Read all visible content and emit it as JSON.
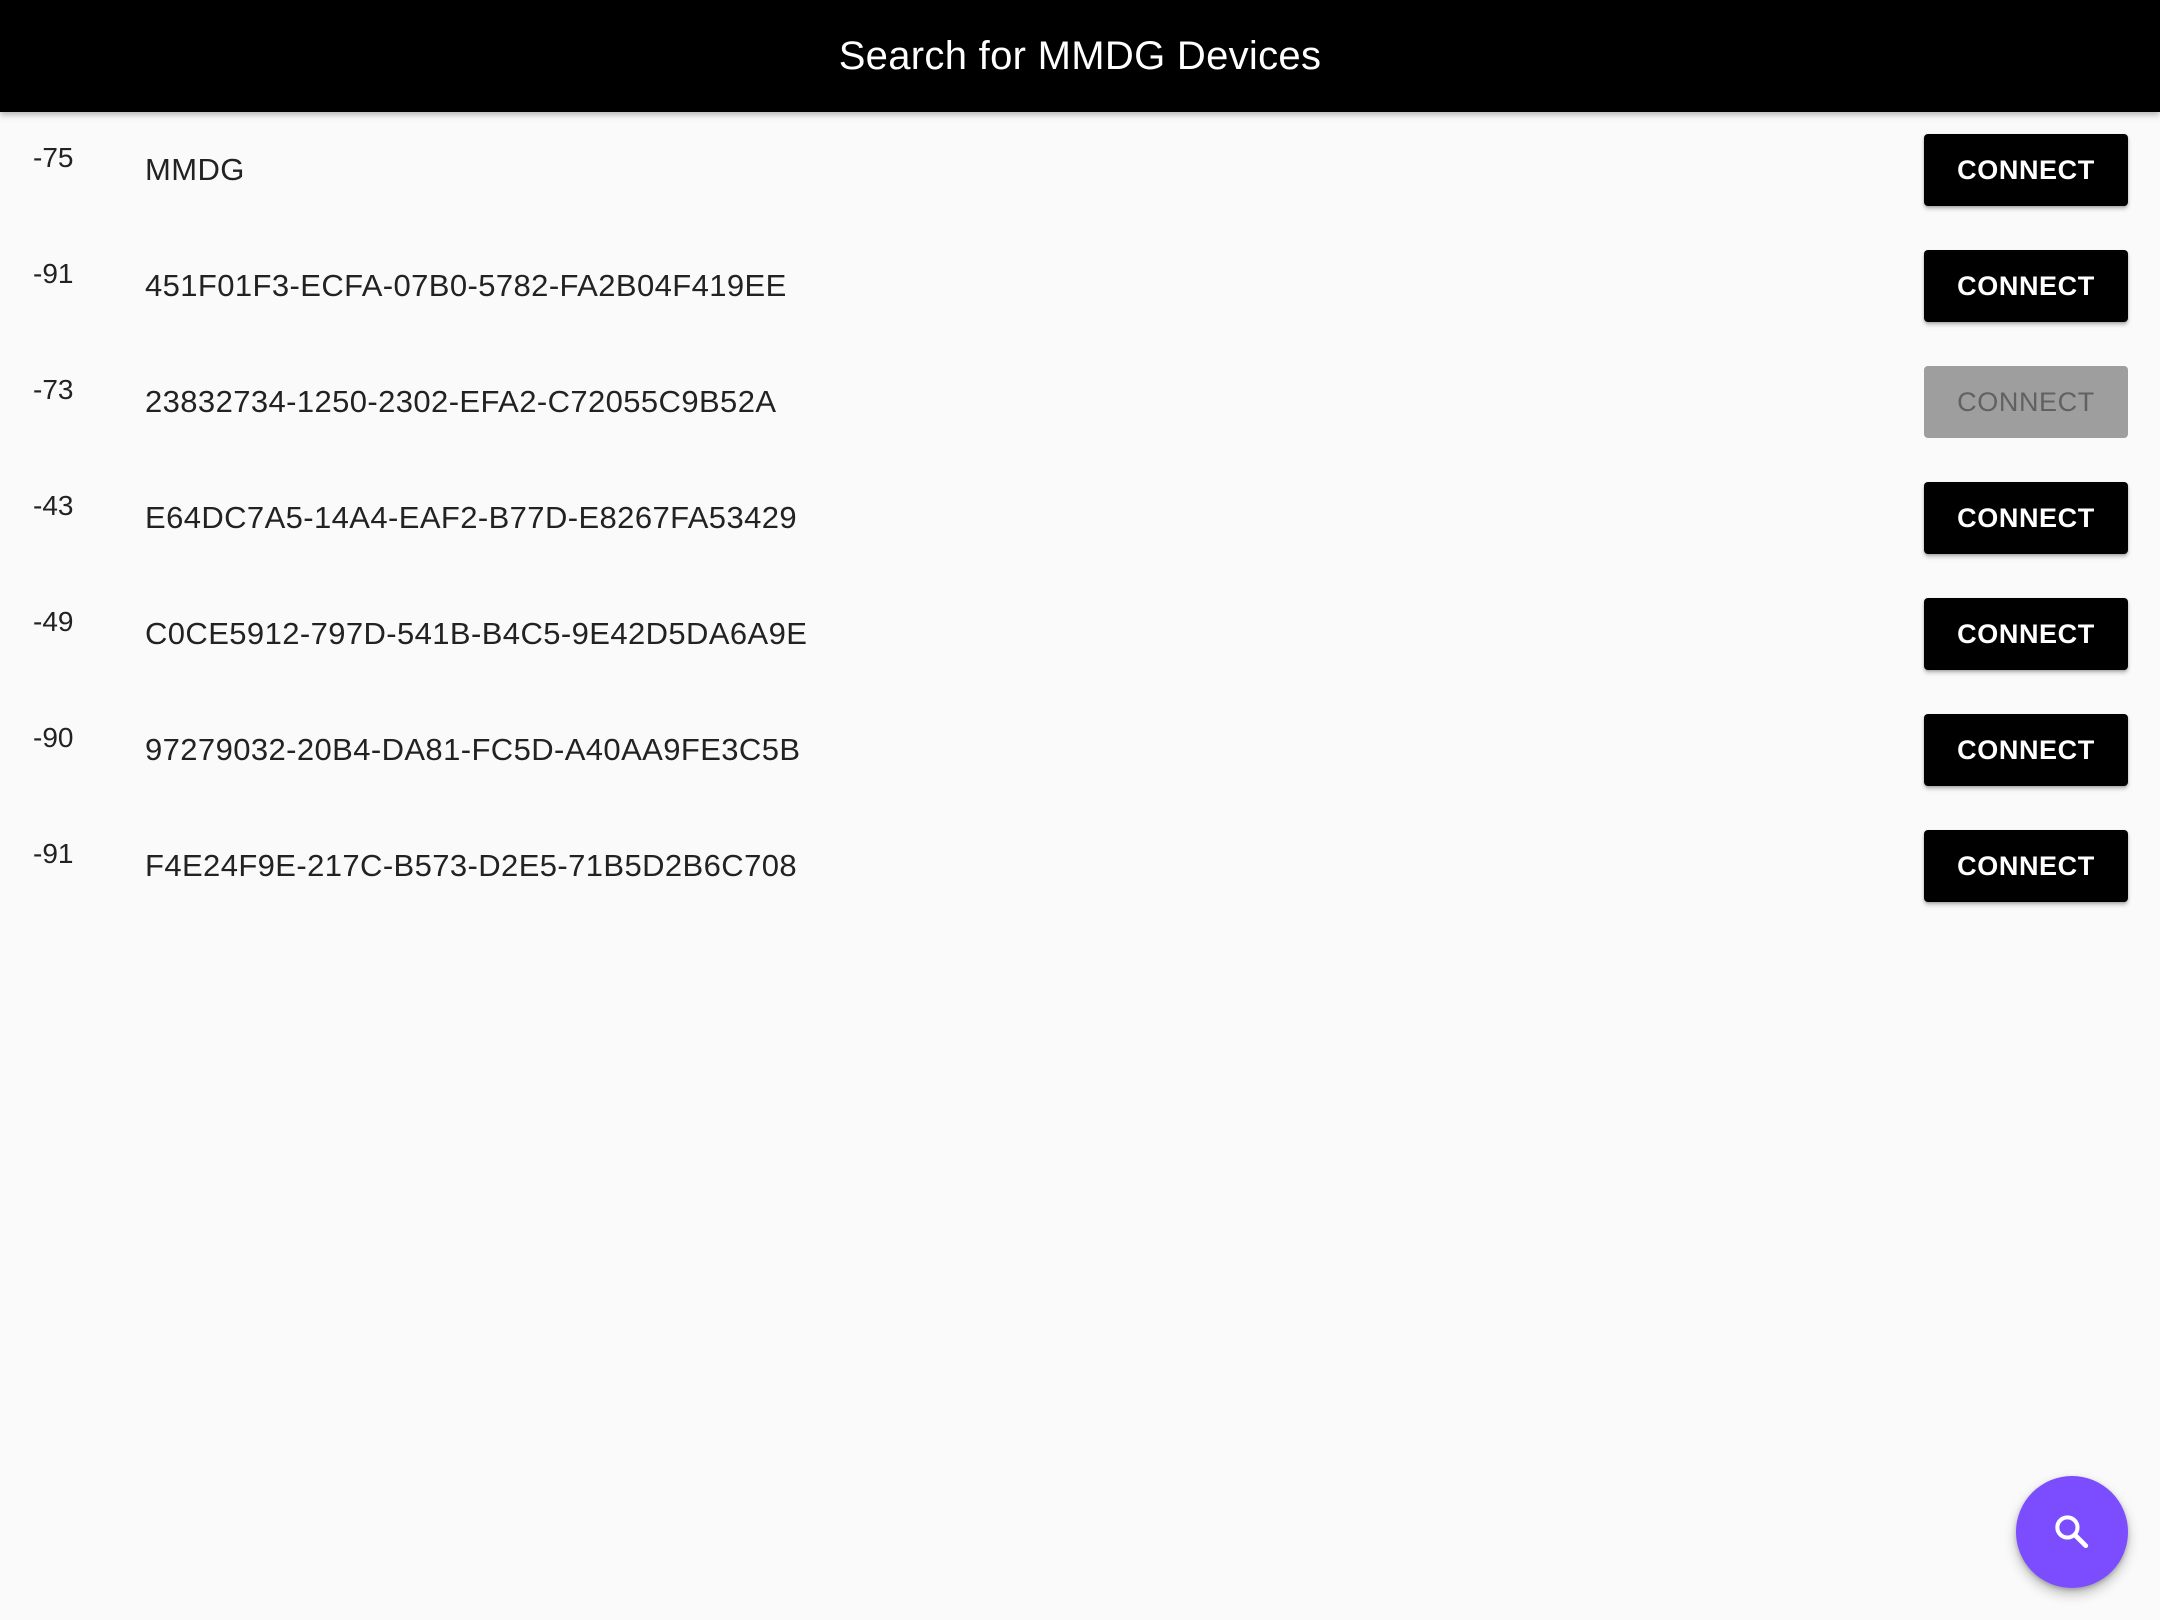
{
  "app_bar": {
    "title": "Search for MMDG Devices"
  },
  "devices": [
    {
      "rssi": "-75",
      "name": "MMDG",
      "button_label": "CONNECT",
      "enabled": true
    },
    {
      "rssi": "-91",
      "name": "451F01F3-ECFA-07B0-5782-FA2B04F419EE",
      "button_label": "CONNECT",
      "enabled": true
    },
    {
      "rssi": "-73",
      "name": "23832734-1250-2302-EFA2-C72055C9B52A",
      "button_label": "CONNECT",
      "enabled": false
    },
    {
      "rssi": "-43",
      "name": "E64DC7A5-14A4-EAF2-B77D-E8267FA53429",
      "button_label": "CONNECT",
      "enabled": true
    },
    {
      "rssi": "-49",
      "name": "C0CE5912-797D-541B-B4C5-9E42D5DA6A9E",
      "button_label": "CONNECT",
      "enabled": true
    },
    {
      "rssi": "-90",
      "name": "97279032-20B4-DA81-FC5D-A40AA9FE3C5B",
      "button_label": "CONNECT",
      "enabled": true
    },
    {
      "rssi": "-91",
      "name": "F4E24F9E-217C-B573-D2E5-71B5D2B6C708",
      "button_label": "CONNECT",
      "enabled": true
    }
  ],
  "fab": {
    "icon": "search-icon",
    "color": "#7c4dff"
  },
  "colors": {
    "app_bar_bg": "#000000",
    "button_bg": "#000000",
    "button_disabled_bg": "#9e9e9e",
    "button_disabled_text": "#616161"
  }
}
